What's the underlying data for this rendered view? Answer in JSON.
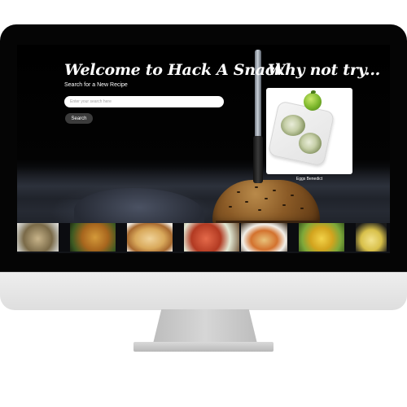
{
  "hero": {
    "title": "Welcome to Hack A Snack",
    "subtitle": "Search for a New Recipe",
    "search_placeholder": "Enter your search here",
    "search_button": "Search"
  },
  "suggestion": {
    "title": "Why not try...",
    "caption": "Eggs Benedict"
  },
  "thumbnails": [
    "food-photo",
    "food-photo",
    "food-photo",
    "food-photo",
    "food-photo",
    "food-photo",
    "food-photo"
  ],
  "colors": {
    "background": "#000000",
    "text": "#ffffff",
    "button": "#3b3b3b",
    "frame_chin": "#e6e6e6"
  }
}
